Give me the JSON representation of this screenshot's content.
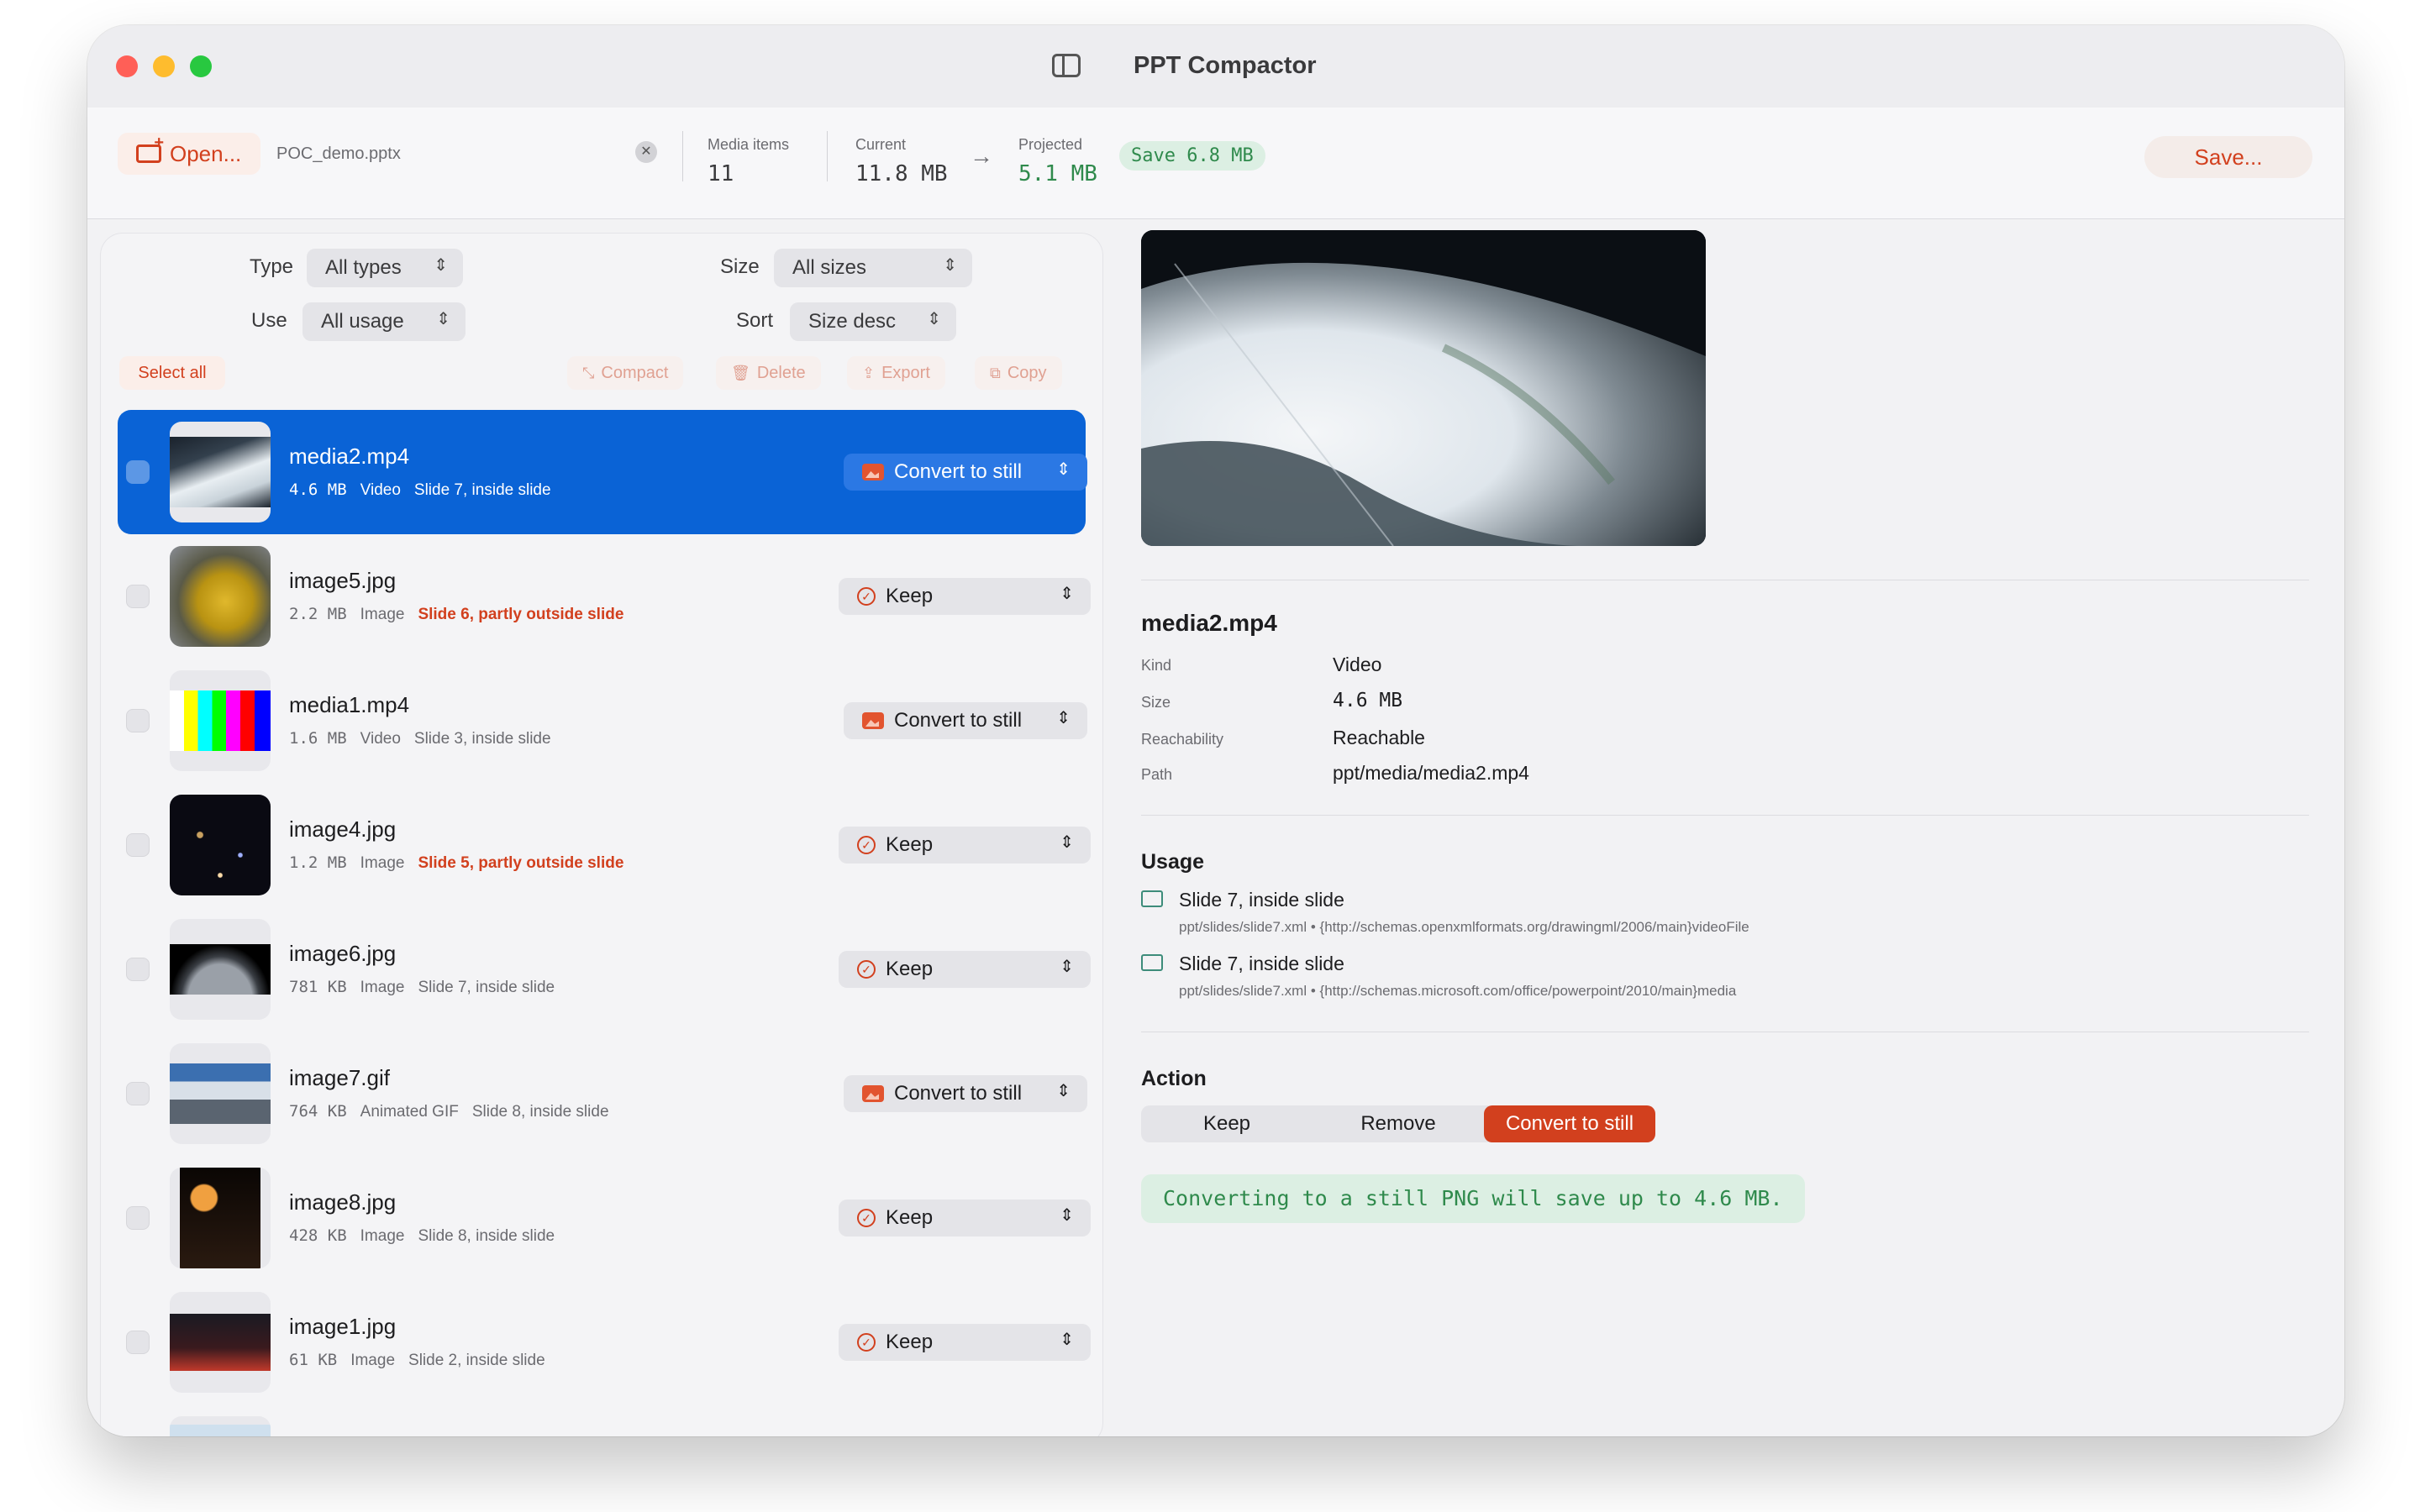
{
  "window": {
    "title": "PPT Compactor"
  },
  "toolbar": {
    "open_label": "Open...",
    "file_name": "POC_demo.pptx",
    "media_items_label": "Media items",
    "media_items_value": "11",
    "current_label": "Current",
    "current_value": "11.8 MB",
    "projected_label": "Projected",
    "projected_value": "5.1 MB",
    "save_badge": "Save 6.8 MB",
    "save_label": "Save..."
  },
  "filters": {
    "type_label": "Type",
    "type_value": "All types",
    "size_label": "Size",
    "size_value": "All sizes",
    "use_label": "Use",
    "use_value": "All usage",
    "sort_label": "Sort",
    "sort_value": "Size desc",
    "select_all": "Select all",
    "compact": "Compact",
    "delete": "Delete",
    "export": "Export",
    "copy": "Copy"
  },
  "items": [
    {
      "name": "media2.mp4",
      "size": "4.6 MB",
      "kind": "Video",
      "location": "Slide 7, inside slide",
      "warn": false,
      "action": "Convert to still",
      "selected": true
    },
    {
      "name": "image5.jpg",
      "size": "2.2 MB",
      "kind": "Image",
      "location": "Slide 6, partly outside slide",
      "warn": true,
      "action": "Keep",
      "selected": false
    },
    {
      "name": "media1.mp4",
      "size": "1.6 MB",
      "kind": "Video",
      "location": "Slide 3, inside slide",
      "warn": false,
      "action": "Convert to still",
      "selected": false
    },
    {
      "name": "image4.jpg",
      "size": "1.2 MB",
      "kind": "Image",
      "location": "Slide 5, partly outside slide",
      "warn": true,
      "action": "Keep",
      "selected": false
    },
    {
      "name": "image6.jpg",
      "size": "781 KB",
      "kind": "Image",
      "location": "Slide 7, inside slide",
      "warn": false,
      "action": "Keep",
      "selected": false
    },
    {
      "name": "image7.gif",
      "size": "764 KB",
      "kind": "Animated GIF",
      "location": "Slide 8, inside slide",
      "warn": false,
      "action": "Convert to still",
      "selected": false
    },
    {
      "name": "image8.jpg",
      "size": "428 KB",
      "kind": "Image",
      "location": "Slide 8, inside slide",
      "warn": false,
      "action": "Keep",
      "selected": false
    },
    {
      "name": "image1.jpg",
      "size": "61 KB",
      "kind": "Image",
      "location": "Slide 2, inside slide",
      "warn": false,
      "action": "Keep",
      "selected": false
    }
  ],
  "detail": {
    "name": "media2.mp4",
    "kind_label": "Kind",
    "kind_value": "Video",
    "size_label": "Size",
    "size_value": "4.6 MB",
    "reach_label": "Reachability",
    "reach_value": "Reachable",
    "path_label": "Path",
    "path_value": "ppt/media/media2.mp4",
    "usage_header": "Usage",
    "usage": [
      {
        "title": "Slide 7, inside slide",
        "path": "ppt/slides/slide7.xml • {http://schemas.openxmlformats.org/drawingml/2006/main}videoFile"
      },
      {
        "title": "Slide 7, inside slide",
        "path": "ppt/slides/slide7.xml • {http://schemas.microsoft.com/office/powerpoint/2010/main}media"
      }
    ],
    "action_header": "Action",
    "actions": [
      "Keep",
      "Remove",
      "Convert to still"
    ],
    "active_action": "Convert to still",
    "hint": "Converting to a still PNG will save up to 4.6 MB."
  },
  "icons": {
    "open": "folder-plus-icon",
    "clear": "clear-x-icon",
    "arrow": "arrow-right-icon",
    "keep": "checkmark-circle-icon",
    "convert": "photo-icon",
    "stepper": "up-down-chevron-icon",
    "sidebar": "sidebar-toggle-icon"
  },
  "colors": {
    "accent": "#d2401e",
    "selection": "#0a63d6",
    "success": "#2f8a4c"
  }
}
